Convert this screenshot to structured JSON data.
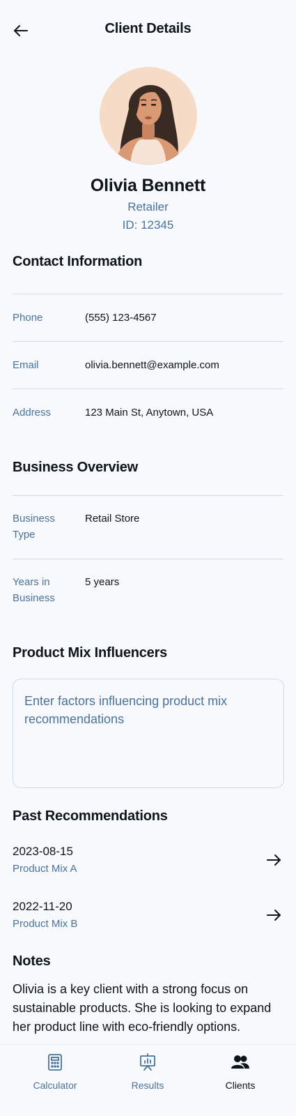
{
  "header": {
    "title": "Client Details",
    "back_icon": "arrow-left-icon"
  },
  "profile": {
    "name": "Olivia Bennett",
    "role": "Retailer",
    "id": "ID: 12345"
  },
  "contact": {
    "title": "Contact Information",
    "rows": [
      {
        "label": "Phone",
        "value": "(555) 123-4567"
      },
      {
        "label": "Email",
        "value": "olivia.bennett@example.com"
      },
      {
        "label": "Address",
        "value": "123 Main St, Anytown, USA"
      }
    ]
  },
  "business": {
    "title": "Business Overview",
    "rows": [
      {
        "label": "Business Type",
        "value": "Retail Store"
      },
      {
        "label": "Years in Business",
        "value": "5 years"
      }
    ]
  },
  "influencers": {
    "title": "Product Mix Influencers",
    "placeholder": "Enter factors influencing product mix recommendations"
  },
  "recommendations": {
    "title": "Past Recommendations",
    "items": [
      {
        "date": "2023-08-15",
        "mix": "Product Mix A"
      },
      {
        "date": "2022-11-20",
        "mix": "Product Mix B"
      }
    ]
  },
  "notes": {
    "title": "Notes",
    "text": "Olivia is a key client with a strong focus on sustainable products. She is looking to expand her product line with eco-friendly options."
  },
  "nav": {
    "items": [
      {
        "label": "Calculator",
        "icon": "calculator-icon"
      },
      {
        "label": "Results",
        "icon": "presentation-chart-icon"
      },
      {
        "label": "Clients",
        "icon": "users-icon",
        "active": true
      }
    ]
  },
  "colors": {
    "accent": "#49739c",
    "text": "#0d141c",
    "divider": "#cedbe8",
    "background": "#f7f9fc"
  }
}
